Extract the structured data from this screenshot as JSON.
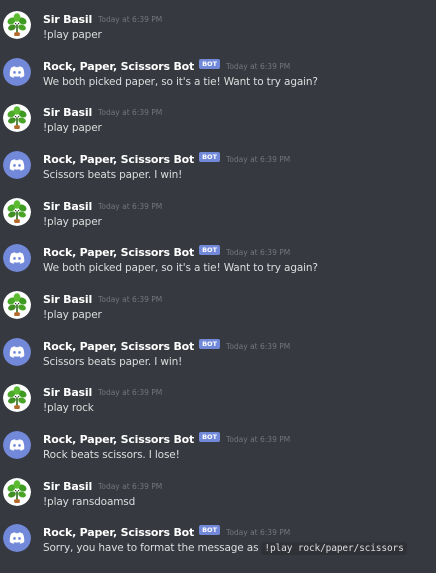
{
  "colors": {
    "background": "#36393f",
    "username": "#ffffff",
    "timestamp": "#72767d",
    "text": "#dcddde",
    "bot_tag": "#7289da",
    "bot_avatar": "#7289da",
    "basil_avatar": "#ffffff"
  },
  "messages": [
    {
      "author": "Sir Basil",
      "bot": false,
      "avatar": "basil-plant-avatar",
      "timestamp": "Today at 6:39 PM",
      "text": "!play paper"
    },
    {
      "author": "Rock, Paper, Scissors Bot",
      "bot": true,
      "bot_tag": "BOT",
      "avatar": "discord-logo-avatar",
      "timestamp": "Today at 6:39 PM",
      "text": "We both picked paper, so it's a tie! Want to try again?"
    },
    {
      "author": "Sir Basil",
      "bot": false,
      "avatar": "basil-plant-avatar",
      "timestamp": "Today at 6:39 PM",
      "text": "!play paper"
    },
    {
      "author": "Rock, Paper, Scissors Bot",
      "bot": true,
      "bot_tag": "BOT",
      "avatar": "discord-logo-avatar",
      "timestamp": "Today at 6:39 PM",
      "text": "Scissors beats paper. I win!"
    },
    {
      "author": "Sir Basil",
      "bot": false,
      "avatar": "basil-plant-avatar",
      "timestamp": "Today at 6:39 PM",
      "text": "!play paper"
    },
    {
      "author": "Rock, Paper, Scissors Bot",
      "bot": true,
      "bot_tag": "BOT",
      "avatar": "discord-logo-avatar",
      "timestamp": "Today at 6:39 PM",
      "text": "We both picked paper, so it's a tie! Want to try again?"
    },
    {
      "author": "Sir Basil",
      "bot": false,
      "avatar": "basil-plant-avatar",
      "timestamp": "Today at 6:39 PM",
      "text": "!play paper"
    },
    {
      "author": "Rock, Paper, Scissors Bot",
      "bot": true,
      "bot_tag": "BOT",
      "avatar": "discord-logo-avatar",
      "timestamp": "Today at 6:39 PM",
      "text": "Scissors beats paper. I win!"
    },
    {
      "author": "Sir Basil",
      "bot": false,
      "avatar": "basil-plant-avatar",
      "timestamp": "Today at 6:39 PM",
      "text": "!play rock"
    },
    {
      "author": "Rock, Paper, Scissors Bot",
      "bot": true,
      "bot_tag": "BOT",
      "avatar": "discord-logo-avatar",
      "timestamp": "Today at 6:39 PM",
      "text": "Rock beats scissors. I lose!"
    },
    {
      "author": "Sir Basil",
      "bot": false,
      "avatar": "basil-plant-avatar",
      "timestamp": "Today at 6:39 PM",
      "text": "!play ransdoamsd"
    },
    {
      "author": "Rock, Paper, Scissors Bot",
      "bot": true,
      "bot_tag": "BOT",
      "avatar": "discord-logo-avatar",
      "timestamp": "Today at 6:39 PM",
      "text": "Sorry, you have to format the message as",
      "code": "!play rock/paper/scissors"
    }
  ]
}
